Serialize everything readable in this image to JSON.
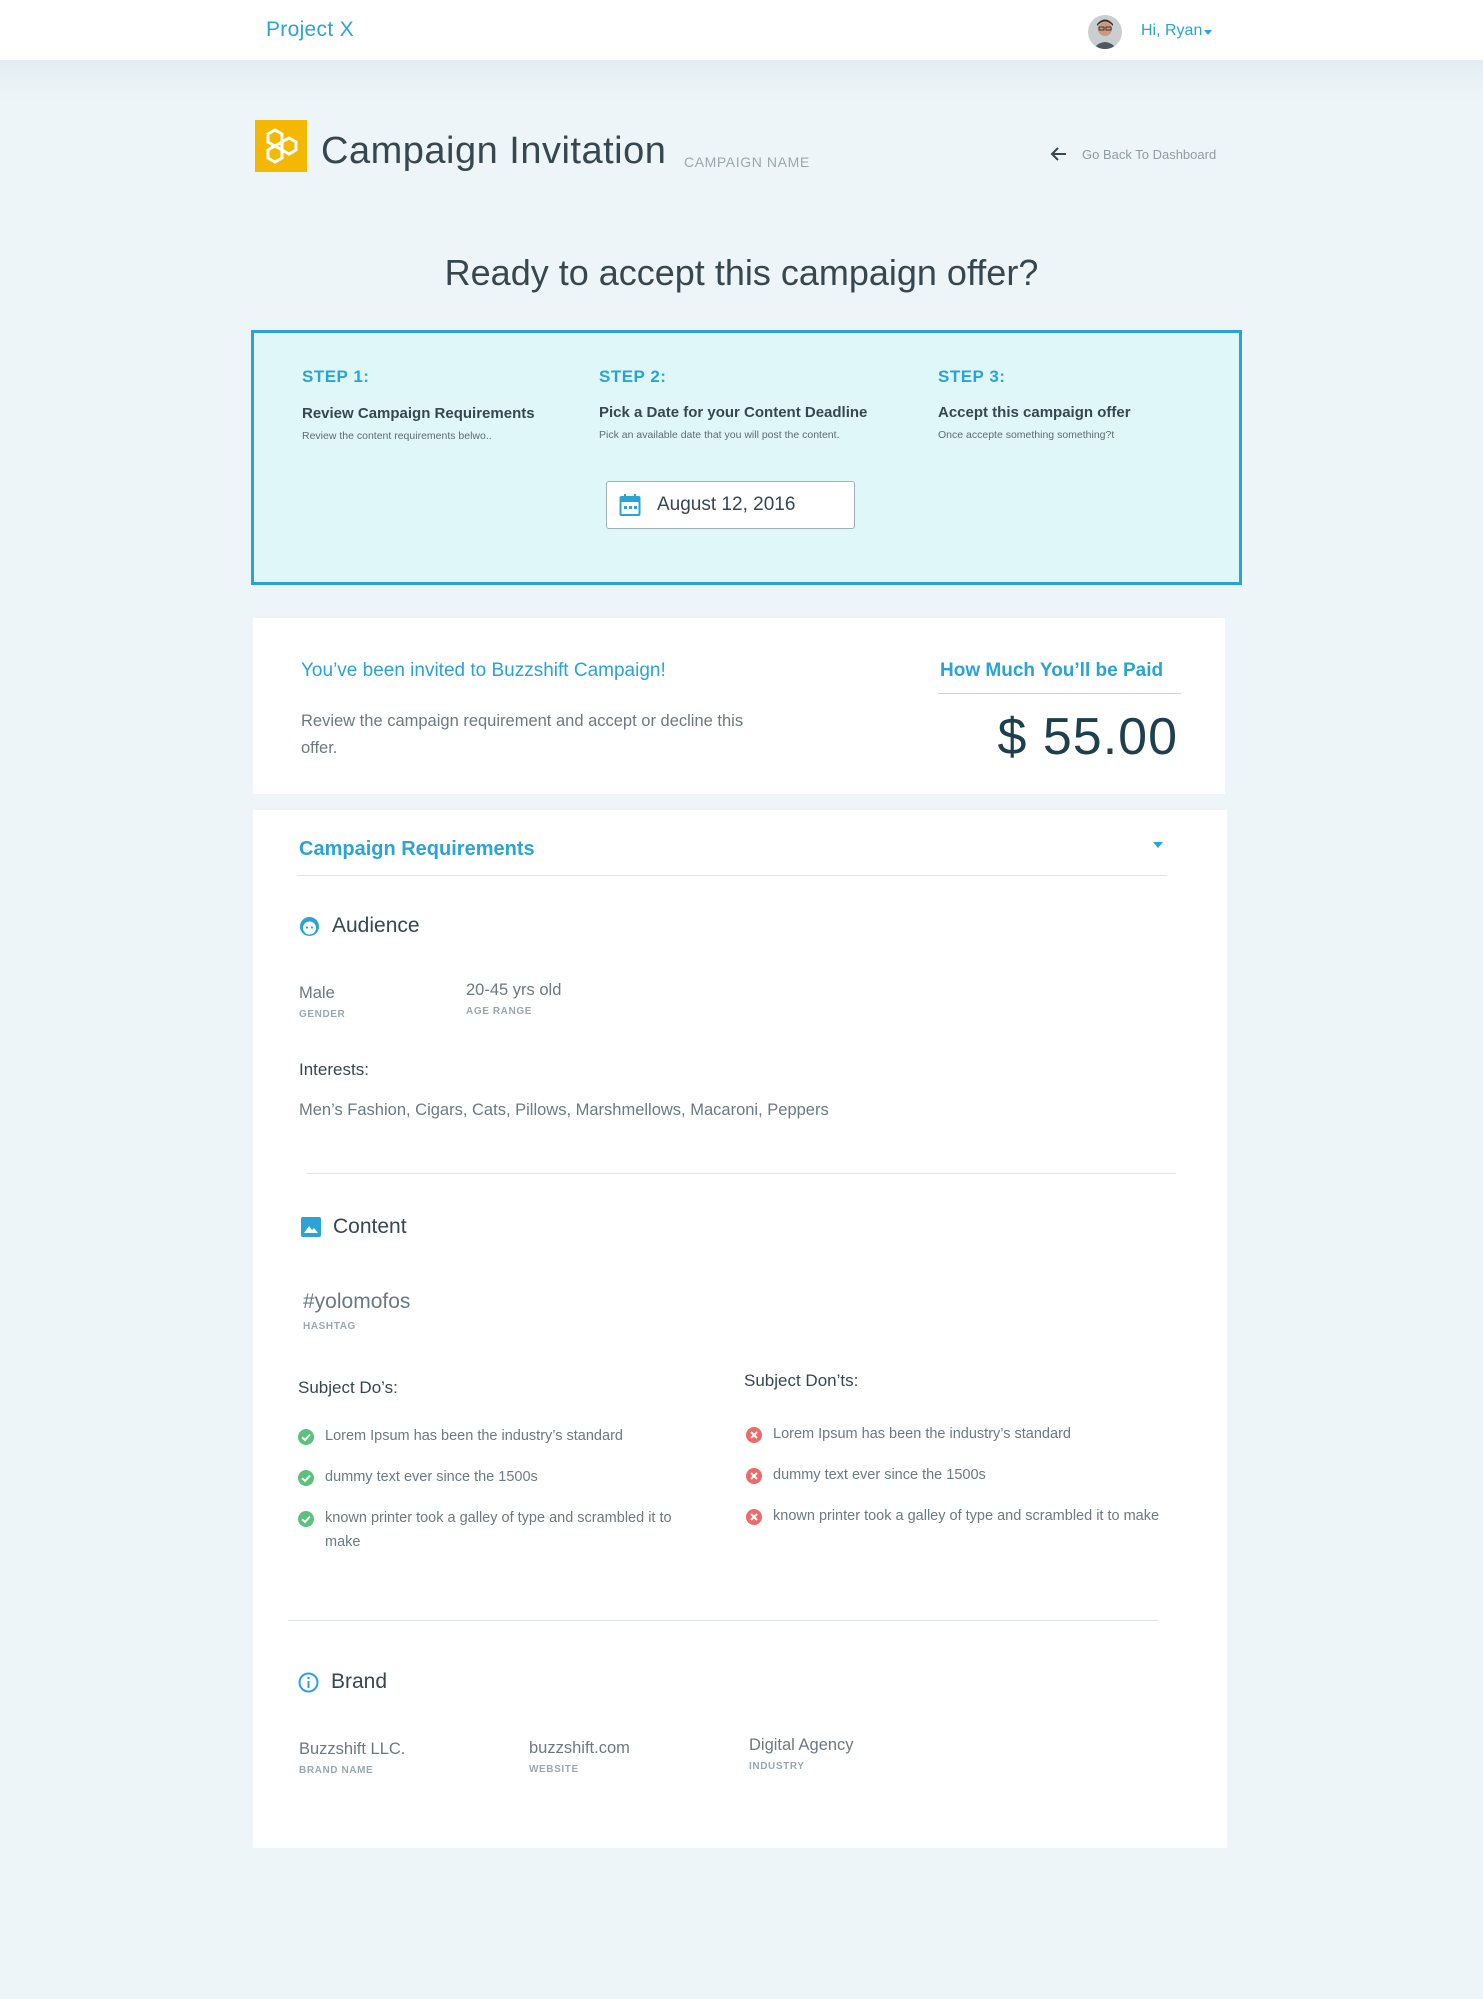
{
  "topbar": {
    "app_name": "Project X",
    "greeting": "Hi, Ryan"
  },
  "header": {
    "title": "Campaign Invitation",
    "subtitle": "CAMPAIGN NAME",
    "back_label": "Go Back To Dashboard"
  },
  "question": "Ready to accept this campaign offer?",
  "steps": [
    {
      "number": "STEP 1:",
      "title": "Review Campaign Requirements",
      "desc": "Review the  content requirements belwo.."
    },
    {
      "number": "STEP 2:",
      "title": "Pick a Date for your Content Deadline",
      "desc": "Pick an available date that you will post the content."
    },
    {
      "number": "STEP 3:",
      "title": "Accept this campaign offer",
      "desc": "Once accepte something something?t"
    }
  ],
  "deadline_date": "August 12, 2016",
  "invite": {
    "title": "You’ve been invited to Buzzshift Campaign!",
    "desc": "Review the campaign requirement and accept or decline this offer.",
    "paid_title": "How Much You’ll be Paid",
    "amount": "$ 55.00"
  },
  "requirements": {
    "title": "Campaign Requirements",
    "audience": {
      "heading": "Audience",
      "gender_value": "Male",
      "gender_label": "GENDER",
      "age_value": "20-45 yrs old",
      "age_label": "AGE RANGE",
      "interests_label": "Interests:",
      "interests_value": "Men’s Fashion, Cigars, Cats, Pillows, Marshmellows, Macaroni, Peppers"
    },
    "content": {
      "heading": "Content",
      "hashtag_value": "#yolomofos",
      "hashtag_label": "HASHTAG",
      "dos_label": "Subject Do’s:",
      "donts_label": "Subject Don’ts:",
      "dos": [
        "Lorem Ipsum has been the industry’s standard",
        "dummy text ever since the 1500s",
        "known printer took a galley of type and scrambled it to make"
      ],
      "donts": [
        "Lorem Ipsum has been the industry’s standard",
        "dummy text ever since the 1500s",
        "known printer took a galley of type and scrambled it to make"
      ]
    },
    "brand": {
      "heading": "Brand",
      "name_value": "Buzzshift LLC.",
      "name_label": "BRAND NAME",
      "website_value": "buzzshift.com",
      "website_label": "WEBSITE",
      "industry_value": "Digital Agency",
      "industry_label": "INDUSTRY"
    }
  },
  "colors": {
    "accent": "#2ba3d4",
    "logo": "#f5b800",
    "success": "#5cc17d",
    "danger": "#ec6a6a"
  },
  "icons": [
    "hexagon-logo-icon",
    "arrow-left-icon",
    "calendar-icon",
    "face-icon",
    "image-icon",
    "info-icon",
    "check-circle-icon",
    "x-circle-icon",
    "chevron-down-icon"
  ]
}
